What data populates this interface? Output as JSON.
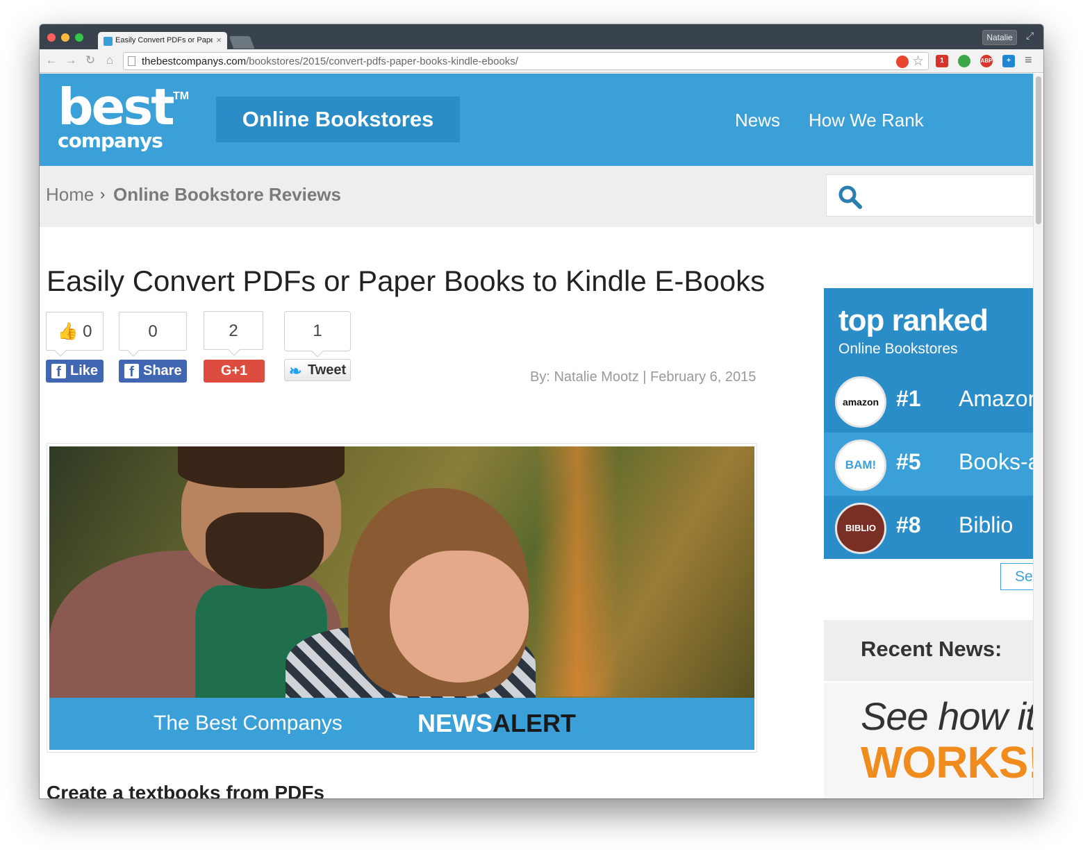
{
  "browser": {
    "tab_title": "Easily Convert PDFs or Paper Books to Kindle E-Books",
    "tab_close": "×",
    "user_button": "Natalie",
    "url_host": "thebestcompanys.com",
    "url_path": "/bookstores/2015/convert-pdfs-paper-books-kindle-ebooks/",
    "back_icon": "←",
    "forward_icon": "→",
    "reload_icon": "↻",
    "home_icon": "⌂",
    "star_icon": "☆",
    "menu_icon": "≡",
    "fullscreen_icon": "⤢",
    "ext_abp_label": "ABP",
    "ext_badge_label": "1"
  },
  "header": {
    "logo_best": "best",
    "logo_tm": "TM",
    "logo_companys": "companys",
    "category": "Online Bookstores",
    "nav": [
      {
        "label": "News"
      },
      {
        "label": "How We Rank"
      }
    ]
  },
  "breadcrumb": {
    "home": "Home",
    "separator": "›",
    "current": "Online Bookstore Reviews"
  },
  "article": {
    "title": "Easily Convert PDFs or Paper Books to Kindle E-Books",
    "social": {
      "like_count": "0",
      "share_count": "0",
      "gplus_count": "2",
      "tweet_count": "1",
      "like_label": "Like",
      "share_label": "Share",
      "gplus_label": "G+1",
      "tweet_label": "Tweet",
      "fb_glyph": "f"
    },
    "byline": "By: Natalie Mootz  |  February 6, 2015",
    "hero": {
      "banner_left": "The Best Companys",
      "banner_news": "NEWS",
      "banner_alert": "ALERT"
    },
    "subheading": "Create a textbooks from PDFs"
  },
  "sidebar": {
    "top_ranked_title": "top ranked",
    "top_ranked_sub": "Online Bookstores",
    "ranks": [
      {
        "logo": "amazon",
        "num": "#1",
        "name": "Amazon"
      },
      {
        "logo": "BAM!",
        "num": "#5",
        "name": "Books-a-Million"
      },
      {
        "logo": "BIBLIO",
        "num": "#8",
        "name": "Biblio"
      }
    ],
    "see_button": "See All",
    "recent_news": "Recent News:",
    "promo_line1": "See how it",
    "promo_line2": "WORKS!"
  },
  "colors": {
    "brand_blue": "#3ba0d8",
    "brand_dark_blue": "#2a8dc8",
    "facebook": "#4267b2",
    "google_plus": "#dc4c3f",
    "promo_orange": "#f08c1e"
  }
}
